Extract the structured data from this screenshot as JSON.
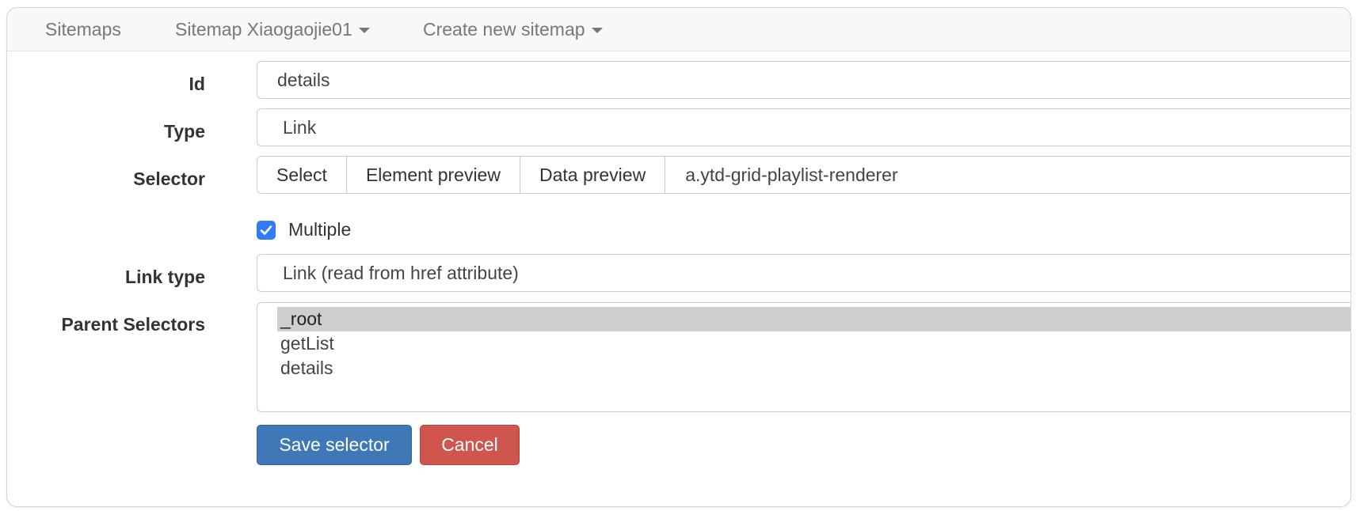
{
  "navbar": {
    "sitemaps": "Sitemaps",
    "current_sitemap": "Sitemap Xiaogaojie01",
    "create_new": "Create new sitemap"
  },
  "form": {
    "id": {
      "label": "Id",
      "value": "details"
    },
    "type": {
      "label": "Type",
      "value": "Link"
    },
    "selector": {
      "label": "Selector",
      "buttons": [
        "Select",
        "Element preview",
        "Data preview"
      ],
      "value": "a.ytd-grid-playlist-renderer"
    },
    "multiple": {
      "label": "Multiple",
      "checked": true
    },
    "link_type": {
      "label": "Link type",
      "value": "Link (read from href attribute)"
    },
    "parent_selectors": {
      "label": "Parent Selectors",
      "options": [
        "_root",
        "getList",
        "details"
      ],
      "selected": "_root"
    },
    "actions": {
      "save": "Save selector",
      "cancel": "Cancel"
    }
  },
  "colors": {
    "checkbox": "#2f7cf6",
    "save_button": "#3f78b6",
    "cancel_button": "#cf554f",
    "selected_option": "#cecece"
  }
}
